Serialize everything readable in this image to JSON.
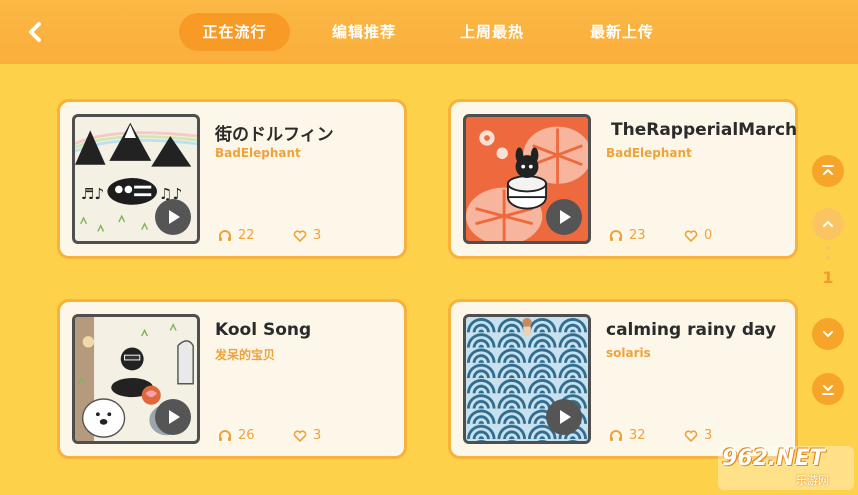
{
  "header": {
    "tabs": [
      {
        "label": "正在流行",
        "active": true
      },
      {
        "label": "编辑推荐",
        "active": false
      },
      {
        "label": "上周最热",
        "active": false
      },
      {
        "label": "最新上传",
        "active": false
      }
    ]
  },
  "songs": [
    {
      "title": "街のドルフィン",
      "author": "BadElephant",
      "plays": "22",
      "likes": "3",
      "cover": "mountains-skeleton"
    },
    {
      "title": "TheRapperialMarch",
      "author": "BadElephant",
      "plays": "23",
      "likes": "0",
      "cover": "leaves-drum"
    },
    {
      "title": "Kool Song",
      "author": "发呆的宝贝",
      "plays": "26",
      "likes": "3",
      "cover": "animals-band"
    },
    {
      "title": "calming rainy day",
      "author": "solaris",
      "plays": "32",
      "likes": "3",
      "cover": "waves-pattern"
    }
  ],
  "pager": {
    "current": "1"
  },
  "watermark": {
    "brand": "962.NET",
    "sub": "乐游网"
  },
  "colors": {
    "accent": "#f7a52a",
    "background": "#fdd24a",
    "author": "#f0a23a"
  }
}
